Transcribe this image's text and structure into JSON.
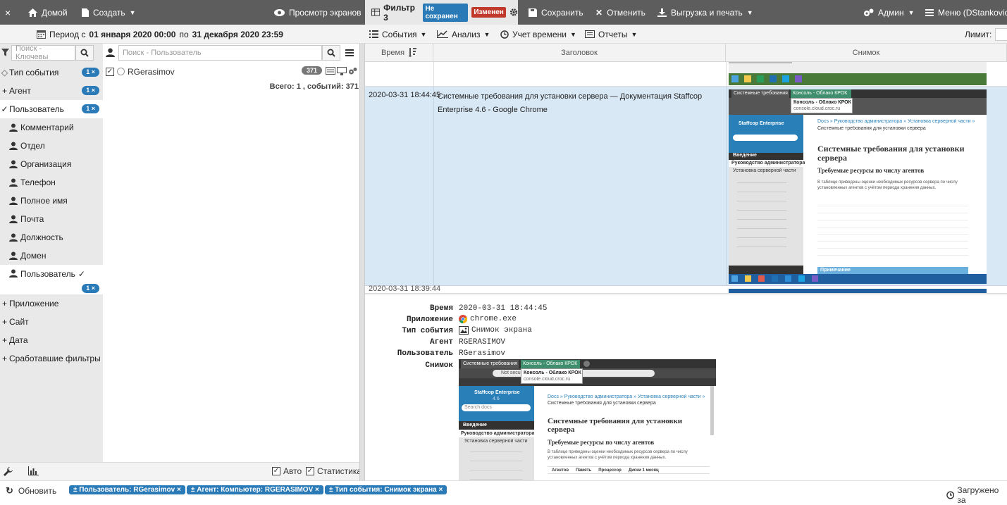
{
  "topbar": {
    "close": "×",
    "home": "Домой",
    "create": "Создать",
    "view_screens": "Просмотр экранов",
    "filter_name": "Фильтр 3",
    "badge_unsaved": "Не сохранен",
    "badge_changed": "Изменен",
    "save": "Сохранить",
    "cancel": "Отменить",
    "export": "Выгрузка и печать",
    "admin": "Админ",
    "menu": "Меню (DStankovich"
  },
  "period": {
    "prefix": "Период с",
    "from": "01 января 2020 00:00",
    "mid": "по",
    "to": "31 декабря 2020 23:59"
  },
  "menu2": {
    "events": "События",
    "analysis": "Анализ",
    "time": "Учет времени",
    "reports": "Отчеты",
    "limit": "Лимит:"
  },
  "search": {
    "keywords_placeholder": "Поиск - Ключевы",
    "user_placeholder": "Поиск - Пользователь"
  },
  "nav": {
    "event_type": "Тип события",
    "agent": "Агент",
    "user": "Пользователь",
    "comment": "Комментарий",
    "dept": "Отдел",
    "org": "Организация",
    "phone": "Телефон",
    "fullname": "Полное имя",
    "mail": "Почта",
    "position": "Должность",
    "domain": "Домен",
    "user2": "Пользователь",
    "app": "Приложение",
    "site": "Сайт",
    "date": "Дата",
    "triggered": "Сработавшие фильтры",
    "count_label": "1 ×"
  },
  "users": {
    "name": "RGerasimov",
    "count": "371",
    "total": "Всего: 1 , событий: 371"
  },
  "bottomleft": {
    "auto": "Авто",
    "stats": "Статистика"
  },
  "grid": {
    "col_time": "Время",
    "col_title": "Заголовок",
    "col_shot": "Снимок",
    "row_time": "2020-03-31 18:44:45",
    "row_title": "Системные требования для установки сервера — Документация Staffcop Enterprise 4.6 - Google Chrome",
    "next_time": "2020-03-31 18:39:44"
  },
  "detail": {
    "labels": {
      "time": "Время",
      "app": "Приложение",
      "type": "Тип события",
      "agent": "Агент",
      "user": "Пользователь",
      "shot": "Снимок"
    },
    "values": {
      "time": "2020-03-31 18:44:45",
      "app": "chrome.exe",
      "type": "Снимок экрана",
      "agent": "RGERASIMOV",
      "user": "RGerasimov"
    }
  },
  "screenshot": {
    "tab1": "Системные требования для у",
    "tab2": "Консоль - Облако КРОК",
    "popup_title": "Консоль - Облако КРОК",
    "popup_url": "console.cloud.croc.ru",
    "url": "Not secure",
    "brand": "Staffcop Enterprise",
    "version": "4.6",
    "search": "Search docs",
    "intro": "Введение",
    "admin_guide": "Руководство администратора",
    "server_install": "Установка серверной части",
    "crumbs": "Docs » Руководство администратора » Установка серверной части »",
    "crumb2": "Системные требования для установки сервера",
    "h1": "Системные требования для установки сервера",
    "h2": "Требуемые ресурсы по числу агентов",
    "para": "В таблице приведены оценки необходимых ресурсов сервера по числу установленных агентов с учётом периода хранения данных.",
    "table_head": [
      "Агентов",
      "Память",
      "Процессор",
      "Диски 1 месяц"
    ],
    "note": "Примечание"
  },
  "status": {
    "refresh": "Обновить",
    "chip1": "± Пользователь: RGerasimov ×",
    "chip2": "± Агент: Компьютер: RGERASIMOV ×",
    "chip3": "± Тип события: Снимок экрана ×",
    "loaded": "Загружено за"
  }
}
